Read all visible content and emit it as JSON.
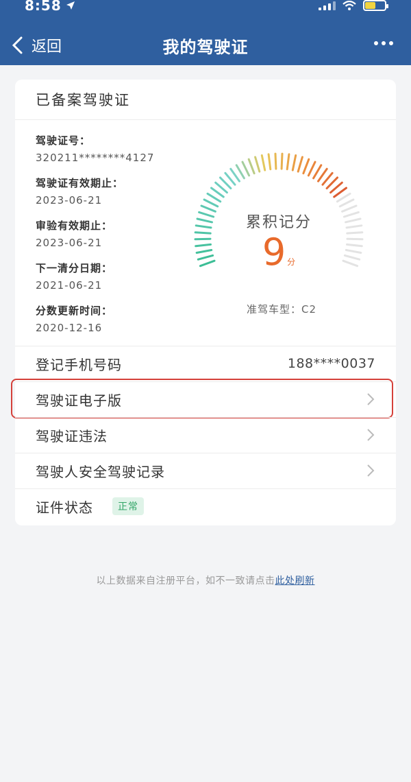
{
  "status_bar": {
    "time": "8:58"
  },
  "nav": {
    "back_label": "返回",
    "title": "我的驾驶证"
  },
  "card": {
    "title": "已备案驾驶证",
    "info": [
      {
        "label": "驾驶证号：",
        "value": "320211********4127"
      },
      {
        "label": "驾驶证有效期止：",
        "value": "2023-06-21"
      },
      {
        "label": "审验有效期止：",
        "value": "2023-06-21"
      },
      {
        "label": "下一清分日期：",
        "value": "2021-06-21"
      },
      {
        "label": "分数更新时间：",
        "value": "2020-12-16"
      }
    ],
    "gauge": {
      "label": "累积记分",
      "score": "9",
      "unit": "分",
      "max": 12
    },
    "car_type": "准驾车型：C2",
    "phone": {
      "label": "登记手机号码",
      "value": "188****0037"
    },
    "rows": [
      {
        "label": "驾驶证电子版"
      },
      {
        "label": "驾驶证违法"
      },
      {
        "label": "驾驶人安全驾驶记录"
      }
    ],
    "status": {
      "label": "证件状态",
      "badge": "正常"
    }
  },
  "footnote": {
    "text": "以上数据来自注册平台，如不一致请点击",
    "link": "此处刷新"
  },
  "colors": {
    "header": "#2f5f9f",
    "score": "#e86a2b",
    "highlight": "#d5403a",
    "badge_bg": "#dff3e8",
    "badge_fg": "#32a567"
  }
}
